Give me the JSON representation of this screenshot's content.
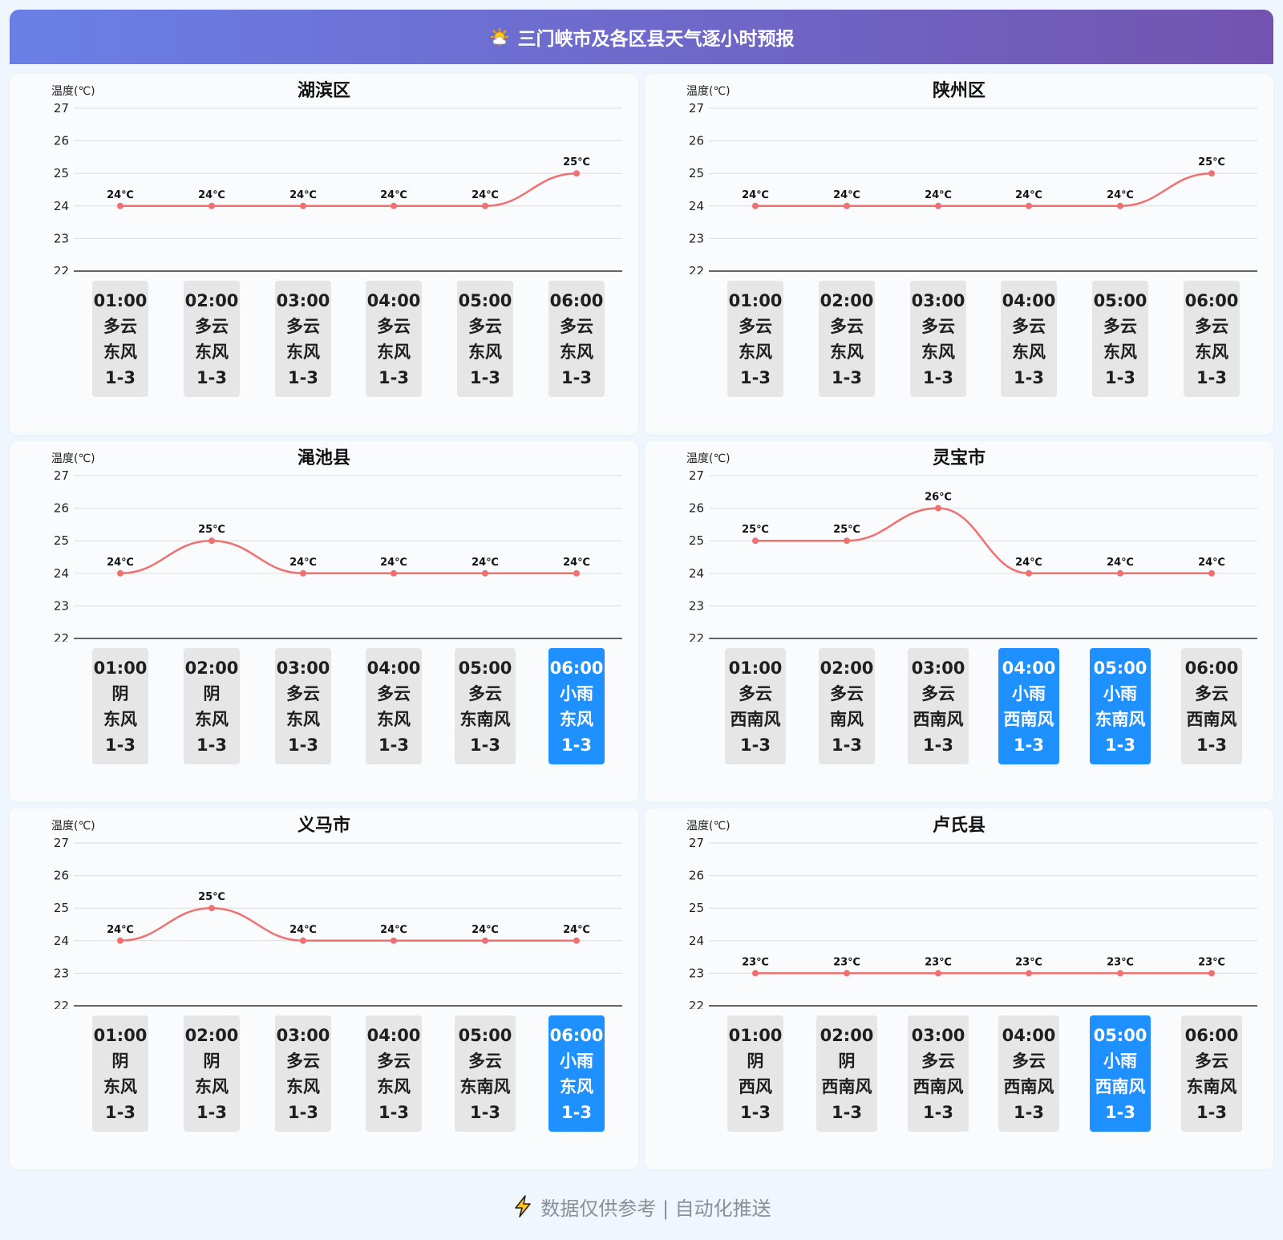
{
  "page": {
    "title": "三门峡市及各区县天气逐小时预报",
    "footer": "数据仅供参考 | 自动化推送"
  },
  "colors": {
    "line": "#f07070",
    "rain_box": "#1e90ff",
    "box": "#e6e6e6",
    "header_from": "#6a7fe6",
    "header_to": "#7254b0"
  },
  "icons": {
    "header": "sun-cloud-icon",
    "footer": "lightning-icon"
  },
  "chart_data": [
    {
      "type": "line",
      "title": "湖滨区",
      "ylabel": "温度(℃)",
      "ylim": [
        22,
        27
      ],
      "yticks": [
        22,
        23,
        24,
        25,
        26,
        27
      ],
      "grid": true,
      "x": [
        "01:00",
        "02:00",
        "03:00",
        "04:00",
        "05:00",
        "06:00"
      ],
      "values": [
        24,
        24,
        24,
        24,
        24,
        25
      ],
      "point_labels": [
        "24℃",
        "24℃",
        "24℃",
        "24℃",
        "24℃",
        "25℃"
      ],
      "hours": [
        {
          "time": "01:00",
          "weather": "多云",
          "wind": "东风",
          "level": "1-3",
          "rain": false
        },
        {
          "time": "02:00",
          "weather": "多云",
          "wind": "东风",
          "level": "1-3",
          "rain": false
        },
        {
          "time": "03:00",
          "weather": "多云",
          "wind": "东风",
          "level": "1-3",
          "rain": false
        },
        {
          "time": "04:00",
          "weather": "多云",
          "wind": "东风",
          "level": "1-3",
          "rain": false
        },
        {
          "time": "05:00",
          "weather": "多云",
          "wind": "东风",
          "level": "1-3",
          "rain": false
        },
        {
          "time": "06:00",
          "weather": "多云",
          "wind": "东风",
          "level": "1-3",
          "rain": false
        }
      ]
    },
    {
      "type": "line",
      "title": "陕州区",
      "ylabel": "温度(℃)",
      "ylim": [
        22,
        27
      ],
      "yticks": [
        22,
        23,
        24,
        25,
        26,
        27
      ],
      "grid": true,
      "x": [
        "01:00",
        "02:00",
        "03:00",
        "04:00",
        "05:00",
        "06:00"
      ],
      "values": [
        24,
        24,
        24,
        24,
        24,
        25
      ],
      "point_labels": [
        "24℃",
        "24℃",
        "24℃",
        "24℃",
        "24℃",
        "25℃"
      ],
      "hours": [
        {
          "time": "01:00",
          "weather": "多云",
          "wind": "东风",
          "level": "1-3",
          "rain": false
        },
        {
          "time": "02:00",
          "weather": "多云",
          "wind": "东风",
          "level": "1-3",
          "rain": false
        },
        {
          "time": "03:00",
          "weather": "多云",
          "wind": "东风",
          "level": "1-3",
          "rain": false
        },
        {
          "time": "04:00",
          "weather": "多云",
          "wind": "东风",
          "level": "1-3",
          "rain": false
        },
        {
          "time": "05:00",
          "weather": "多云",
          "wind": "东风",
          "level": "1-3",
          "rain": false
        },
        {
          "time": "06:00",
          "weather": "多云",
          "wind": "东风",
          "level": "1-3",
          "rain": false
        }
      ]
    },
    {
      "type": "line",
      "title": "渑池县",
      "ylabel": "温度(℃)",
      "ylim": [
        22,
        27
      ],
      "yticks": [
        22,
        23,
        24,
        25,
        26,
        27
      ],
      "grid": true,
      "x": [
        "01:00",
        "02:00",
        "03:00",
        "04:00",
        "05:00",
        "06:00"
      ],
      "values": [
        24,
        25,
        24,
        24,
        24,
        24
      ],
      "point_labels": [
        "24℃",
        "25℃",
        "24℃",
        "24℃",
        "24℃",
        "24℃"
      ],
      "hours": [
        {
          "time": "01:00",
          "weather": "阴",
          "wind": "东风",
          "level": "1-3",
          "rain": false
        },
        {
          "time": "02:00",
          "weather": "阴",
          "wind": "东风",
          "level": "1-3",
          "rain": false
        },
        {
          "time": "03:00",
          "weather": "多云",
          "wind": "东风",
          "level": "1-3",
          "rain": false
        },
        {
          "time": "04:00",
          "weather": "多云",
          "wind": "东风",
          "level": "1-3",
          "rain": false
        },
        {
          "time": "05:00",
          "weather": "多云",
          "wind": "东南风",
          "level": "1-3",
          "rain": false
        },
        {
          "time": "06:00",
          "weather": "小雨",
          "wind": "东风",
          "level": "1-3",
          "rain": true
        }
      ]
    },
    {
      "type": "line",
      "title": "灵宝市",
      "ylabel": "温度(℃)",
      "ylim": [
        22,
        27
      ],
      "yticks": [
        22,
        23,
        24,
        25,
        26,
        27
      ],
      "grid": true,
      "x": [
        "01:00",
        "02:00",
        "03:00",
        "04:00",
        "05:00",
        "06:00"
      ],
      "values": [
        25,
        25,
        26,
        24,
        24,
        24
      ],
      "point_labels": [
        "25℃",
        "25℃",
        "26℃",
        "24℃",
        "24℃",
        "24℃"
      ],
      "hours": [
        {
          "time": "01:00",
          "weather": "多云",
          "wind": "西南风",
          "level": "1-3",
          "rain": false
        },
        {
          "time": "02:00",
          "weather": "多云",
          "wind": "南风",
          "level": "1-3",
          "rain": false
        },
        {
          "time": "03:00",
          "weather": "多云",
          "wind": "西南风",
          "level": "1-3",
          "rain": false
        },
        {
          "time": "04:00",
          "weather": "小雨",
          "wind": "西南风",
          "level": "1-3",
          "rain": true
        },
        {
          "time": "05:00",
          "weather": "小雨",
          "wind": "东南风",
          "level": "1-3",
          "rain": true
        },
        {
          "time": "06:00",
          "weather": "多云",
          "wind": "西南风",
          "level": "1-3",
          "rain": false
        }
      ]
    },
    {
      "type": "line",
      "title": "义马市",
      "ylabel": "温度(℃)",
      "ylim": [
        22,
        27
      ],
      "yticks": [
        22,
        23,
        24,
        25,
        26,
        27
      ],
      "grid": true,
      "x": [
        "01:00",
        "02:00",
        "03:00",
        "04:00",
        "05:00",
        "06:00"
      ],
      "values": [
        24,
        25,
        24,
        24,
        24,
        24
      ],
      "point_labels": [
        "24℃",
        "25℃",
        "24℃",
        "24℃",
        "24℃",
        "24℃"
      ],
      "hours": [
        {
          "time": "01:00",
          "weather": "阴",
          "wind": "东风",
          "level": "1-3",
          "rain": false
        },
        {
          "time": "02:00",
          "weather": "阴",
          "wind": "东风",
          "level": "1-3",
          "rain": false
        },
        {
          "time": "03:00",
          "weather": "多云",
          "wind": "东风",
          "level": "1-3",
          "rain": false
        },
        {
          "time": "04:00",
          "weather": "多云",
          "wind": "东风",
          "level": "1-3",
          "rain": false
        },
        {
          "time": "05:00",
          "weather": "多云",
          "wind": "东南风",
          "level": "1-3",
          "rain": false
        },
        {
          "time": "06:00",
          "weather": "小雨",
          "wind": "东风",
          "level": "1-3",
          "rain": true
        }
      ]
    },
    {
      "type": "line",
      "title": "卢氏县",
      "ylabel": "温度(℃)",
      "ylim": [
        22,
        27
      ],
      "yticks": [
        22,
        23,
        24,
        25,
        26,
        27
      ],
      "grid": true,
      "x": [
        "01:00",
        "02:00",
        "03:00",
        "04:00",
        "05:00",
        "06:00"
      ],
      "values": [
        23,
        23,
        23,
        23,
        23,
        23
      ],
      "point_labels": [
        "23℃",
        "23℃",
        "23℃",
        "23℃",
        "23℃",
        "23℃"
      ],
      "hours": [
        {
          "time": "01:00",
          "weather": "阴",
          "wind": "西风",
          "level": "1-3",
          "rain": false
        },
        {
          "time": "02:00",
          "weather": "阴",
          "wind": "西南风",
          "level": "1-3",
          "rain": false
        },
        {
          "time": "03:00",
          "weather": "多云",
          "wind": "西南风",
          "level": "1-3",
          "rain": false
        },
        {
          "time": "04:00",
          "weather": "多云",
          "wind": "西南风",
          "level": "1-3",
          "rain": false
        },
        {
          "time": "05:00",
          "weather": "小雨",
          "wind": "西南风",
          "level": "1-3",
          "rain": true
        },
        {
          "time": "06:00",
          "weather": "多云",
          "wind": "东南风",
          "level": "1-3",
          "rain": false
        }
      ]
    }
  ]
}
